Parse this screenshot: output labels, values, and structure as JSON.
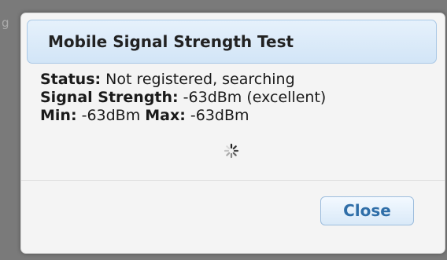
{
  "background": {
    "partial_text": "g"
  },
  "dialog": {
    "title": "Mobile Signal Strength Test",
    "status_label": "Status:",
    "status_value": " Not registered, searching",
    "signal_label": "Signal Strength:",
    "signal_value": " -63dBm (excellent)",
    "min_label": "Min:",
    "min_value": " -63dBm ",
    "max_label": "Max:",
    "max_value": " -63dBm",
    "spinner_icon": "loading-spinner-icon",
    "close_label": "Close"
  },
  "colors": {
    "header_bg": "#d9e9f8",
    "header_border": "#a9c8e6",
    "button_text": "#2f6ea8",
    "dialog_bg": "#f4f4f4"
  }
}
